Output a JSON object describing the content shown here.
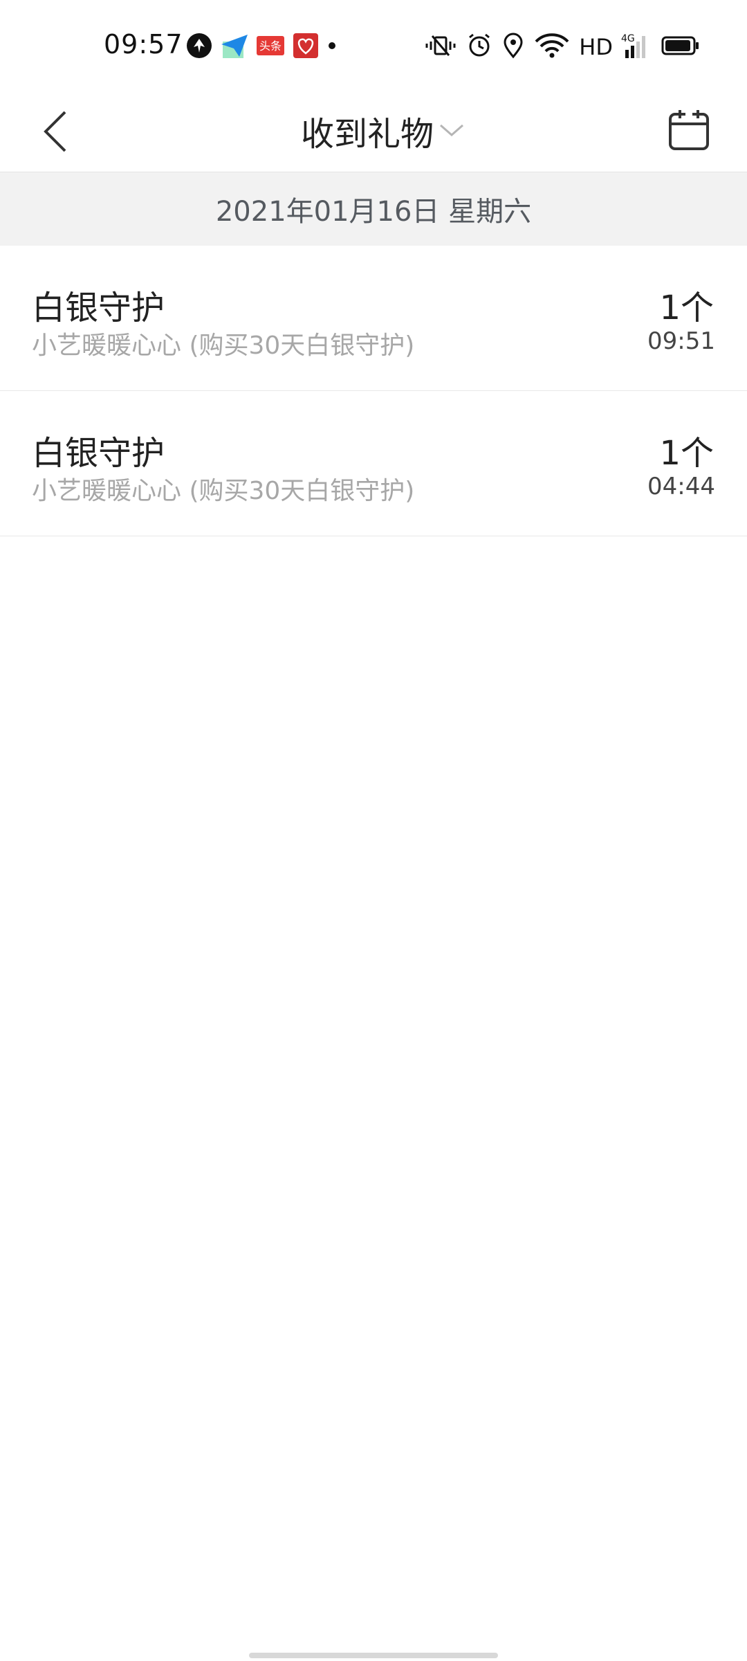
{
  "status_bar": {
    "time": "09:57",
    "notification_icons": [
      "app-icon-black",
      "send-icon",
      "toutiao-icon",
      "gift-app-icon",
      "more-dot-icon"
    ],
    "toutiao_label": "头条",
    "right_icons": [
      "vibrate-icon",
      "alarm-icon",
      "location-icon",
      "wifi-icon"
    ],
    "hd_label": "HD",
    "network_label": "4G",
    "battery_level": 0.95
  },
  "header": {
    "title": "收到礼物",
    "back_icon": "chevron-left-icon",
    "dropdown_icon": "chevron-down-icon",
    "calendar_icon": "calendar-icon"
  },
  "date_band": {
    "label": "2021年01月16日 星期六"
  },
  "gifts": [
    {
      "name": "白银守护",
      "detail": "小艺暖暖心心 (购买30天白银守护)",
      "count": "1个",
      "time": "09:51"
    },
    {
      "name": "白银守护",
      "detail": "小艺暖暖心心 (购买30天白银守护)",
      "count": "1个",
      "time": "04:44"
    }
  ],
  "colors": {
    "toutiao_red": "#e53935",
    "gift_app_red": "#d32f2f",
    "send_blue": "#1e88e5",
    "date_band_bg": "#f2f2f2",
    "secondary_text": "#a7a7a7"
  }
}
